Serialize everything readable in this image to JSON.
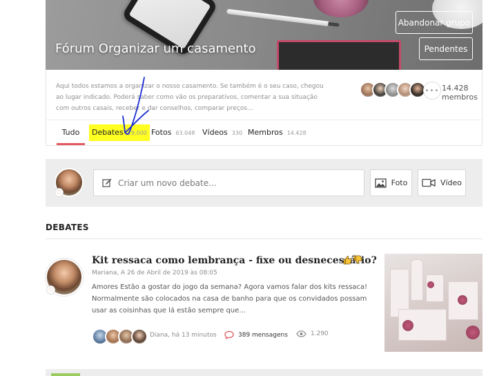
{
  "banner": {
    "title": "Fórum Organizar um casamento",
    "leave_label": "Abandonar grupo",
    "pending_label": "Pendentes"
  },
  "group": {
    "description": "Aqui todos estamos a organizar o nosso casamento. Se também é o seu caso, chegou ao lugar indicado. Poderá saber como vão os preparativos, comentar a sua situação com outros casais, receber e dar conselhos, comparar preços...",
    "members_count": "14.428",
    "members_label": "membros",
    "more_label": "•••"
  },
  "tabs": [
    {
      "label": "Tudo",
      "count": ""
    },
    {
      "label": "Debates",
      "count": "19.000"
    },
    {
      "label": "Fotos",
      "count": "63.048"
    },
    {
      "label": "Vídeos",
      "count": "330"
    },
    {
      "label": "Membros",
      "count": "14.428"
    }
  ],
  "composer": {
    "placeholder": "Criar um novo debate...",
    "photo_label": "Foto",
    "video_label": "Vídeo"
  },
  "debates": {
    "section_title": "DEBATES",
    "posts": [
      {
        "title": "Kit ressaca como lembrança - fixe ou desnecessário?",
        "meta": "Mariana, A 26 de Abril de 2019 às 08:05",
        "body": "Amores Estão a gostar do jogo da semana? Agora vamos falar dos kits ressaca! Normalmente são colocados na casa de banho para que os convidados possam usar as coisinhas que lá estão sempre que...",
        "last_reply": "Diana, há 13 minutos",
        "messages": "389 mensagens",
        "views": "1.290"
      }
    ]
  },
  "colors": {
    "accent": "#e2585e",
    "highlight": "#ffff22",
    "annotation": "#1b2bd6"
  }
}
